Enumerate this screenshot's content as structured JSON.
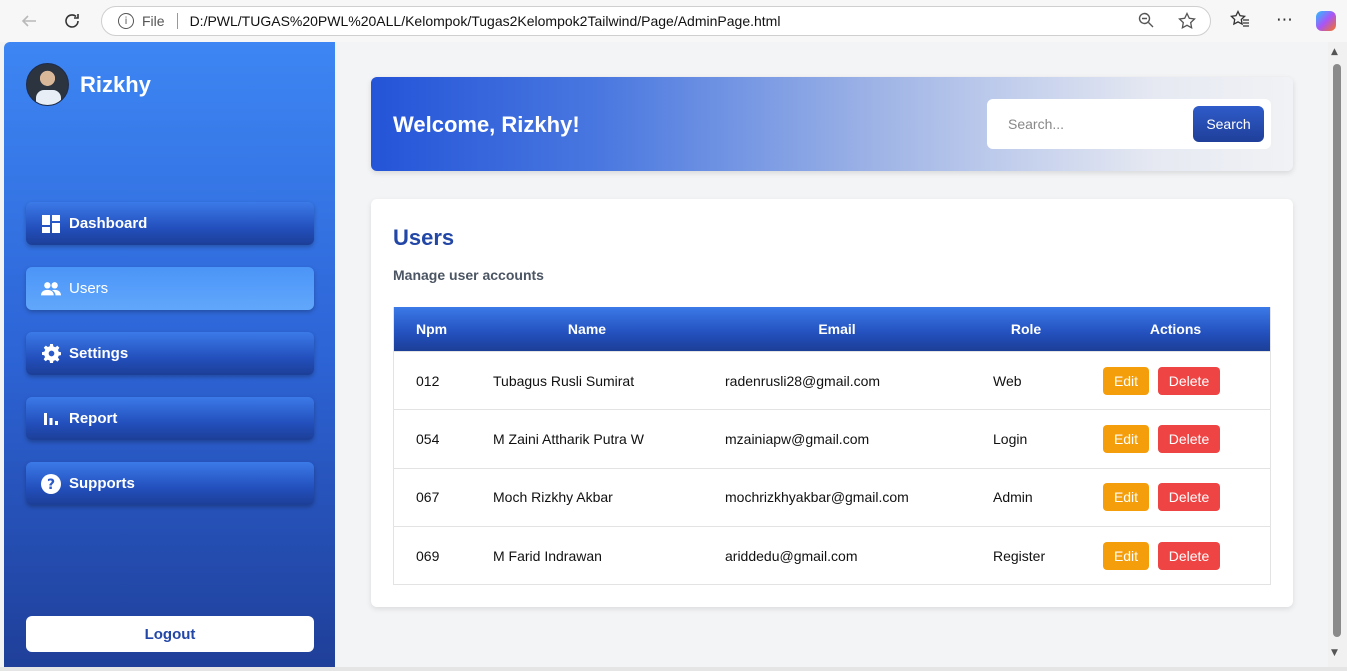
{
  "browser": {
    "file_label": "File",
    "url": "D:/PWL/TUGAS%20PWL%20ALL/Kelompok/Tugas2Kelompok2Tailwind/Page/AdminPage.html"
  },
  "sidebar": {
    "user_name": "Rizkhy",
    "items": [
      {
        "label": "Dashboard",
        "icon": "dashboard-icon"
      },
      {
        "label": "Users",
        "icon": "users-icon"
      },
      {
        "label": "Settings",
        "icon": "gear-icon"
      },
      {
        "label": "Report",
        "icon": "bar-chart-icon"
      },
      {
        "label": "Supports",
        "icon": "help-icon"
      }
    ],
    "active_item": "Users",
    "logout_label": "Logout"
  },
  "header": {
    "welcome": "Welcome, Rizkhy!",
    "search_placeholder": "Search...",
    "search_button": "Search"
  },
  "users": {
    "title": "Users",
    "subtitle": "Manage user accounts",
    "columns": [
      "Npm",
      "Name",
      "Email",
      "Role",
      "Actions"
    ],
    "rows": [
      {
        "npm": "012",
        "name": "Tubagus Rusli Sumirat",
        "email": "radenrusli28@gmail.com",
        "role": "Web"
      },
      {
        "npm": "054",
        "name": "M Zaini Attharik Putra W",
        "email": "mzainiapw@gmail.com",
        "role": "Login"
      },
      {
        "npm": "067",
        "name": "Moch Rizkhy Akbar",
        "email": "mochrizkhyakbar@gmail.com",
        "role": "Admin"
      },
      {
        "npm": "069",
        "name": "M Farid Indrawan",
        "email": "ariddedu@gmail.com",
        "role": "Register"
      }
    ],
    "edit_label": "Edit",
    "delete_label": "Delete"
  },
  "colors": {
    "primary": "#2347a6",
    "edit": "#f59e0b",
    "delete": "#ef4444"
  }
}
